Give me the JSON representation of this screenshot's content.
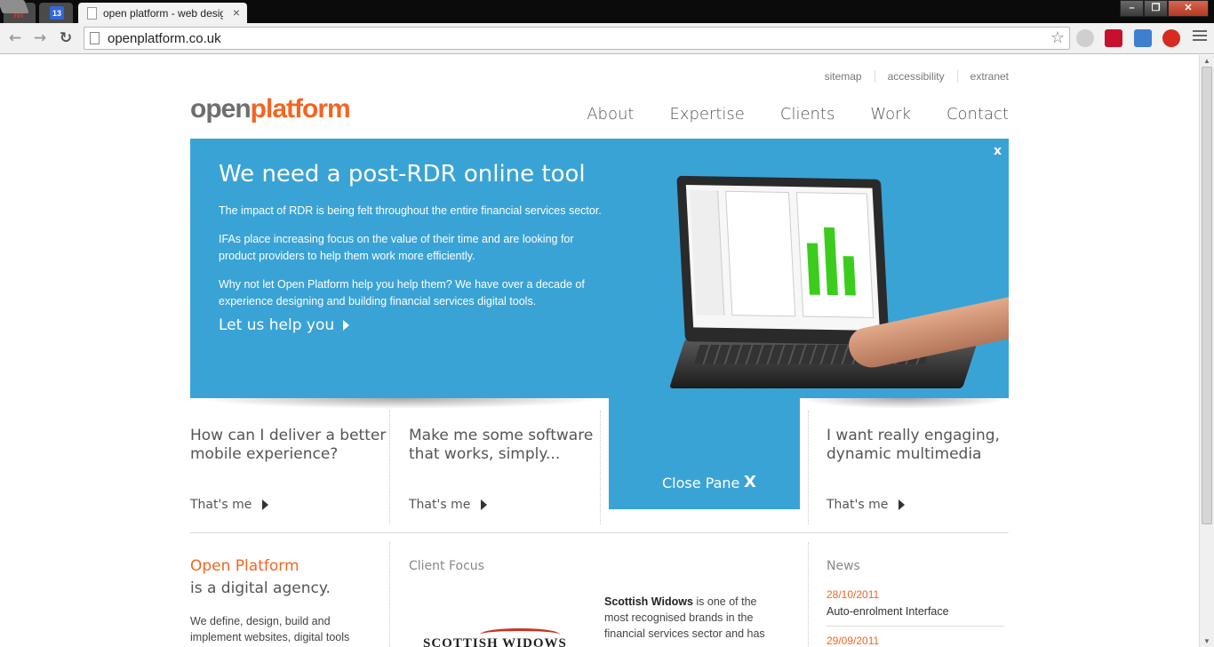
{
  "browser": {
    "tabs": [
      {
        "icon": "gmail-icon",
        "glyph": "M"
      },
      {
        "icon": "calendar-icon",
        "glyph": "13"
      },
      {
        "icon": "page-icon",
        "title": "open platform - web desig",
        "active": true
      }
    ],
    "url": "openplatform.co.uk",
    "window_buttons": [
      "–",
      "❐",
      "✕"
    ]
  },
  "site": {
    "util_links": [
      "sitemap",
      "accessibility",
      "extranet"
    ],
    "logo": {
      "part1": "open",
      "part2": "platform"
    },
    "nav": [
      "About",
      "Expertise",
      "Clients",
      "Work",
      "Contact"
    ],
    "accent": "#f26522",
    "brand_blue": "#3aa3d6"
  },
  "hero": {
    "close": "x",
    "title": "We need a post-RDR online tool",
    "p1": "The impact of RDR is being felt throughout the entire financial services sector.",
    "p2": "IFAs place increasing focus on the value of their time and are looking for product providers to help them work more efficiently.",
    "p3": "Why not let Open Platform help you help them? We have over a decade of experience designing and building financial services digital tools.",
    "cta": "Let us help you"
  },
  "features": [
    {
      "title": "How can I deliver a better mobile experience?",
      "link": "That's me"
    },
    {
      "title": "Make me some software that works, simply...",
      "link": "That's me"
    },
    {
      "title": "I want really engaging, dynamic multimedia",
      "link": "That's me"
    }
  ],
  "close_pane": {
    "label": "Close Pane",
    "icon": "X"
  },
  "about": {
    "title": "Open Platform",
    "subtitle": "is a digital agency.",
    "text": "We define, design, build and implement websites, digital tools"
  },
  "client_focus": {
    "title": "Client Focus",
    "logo_text": "SCOTTISH WIDOWS",
    "name": "Scottish Widows",
    "text": " is one of the most recognised brands in the financial services sector and has"
  },
  "news": {
    "title": "News",
    "items": [
      {
        "date": "28/10/2011",
        "headline": "Auto-enrolment Interface"
      },
      {
        "date": "29/09/2011",
        "headline": ""
      }
    ]
  }
}
